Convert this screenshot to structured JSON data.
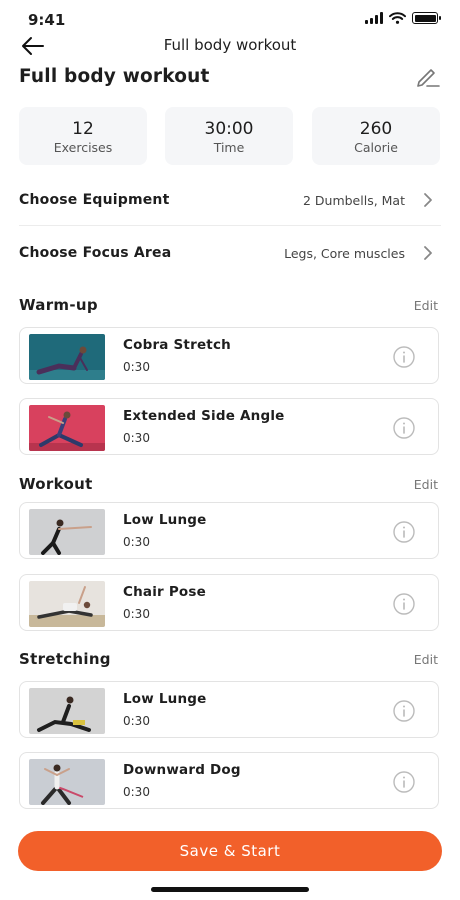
{
  "status_bar": {
    "time": "9:41"
  },
  "nav": {
    "title": "Full body workout"
  },
  "page": {
    "title": "Full body workout"
  },
  "stats": [
    {
      "value": "12",
      "label": "Exercises"
    },
    {
      "value": "30:00",
      "label": "Time"
    },
    {
      "value": "260",
      "label": "Calorie"
    }
  ],
  "settings": {
    "equipment": {
      "label": "Choose Equipment",
      "value": "2 Dumbells, Mat"
    },
    "focus": {
      "label": "Choose Focus Area",
      "value": "Legs, Core muscles"
    }
  },
  "sections": {
    "warmup": {
      "title": "Warm-up",
      "edit_label": "Edit",
      "items": [
        {
          "name": "Cobra Stretch",
          "duration": "0:30"
        },
        {
          "name": "Extended Side Angle",
          "duration": "0:30"
        }
      ]
    },
    "workout": {
      "title": "Workout",
      "edit_label": "Edit",
      "items": [
        {
          "name": "Low Lunge",
          "duration": "0:30"
        },
        {
          "name": "Chair Pose",
          "duration": "0:30"
        }
      ]
    },
    "stretching": {
      "title": "Stretching",
      "edit_label": "Edit",
      "items": [
        {
          "name": "Low Lunge",
          "duration": "0:30"
        },
        {
          "name": "Downward Dog",
          "duration": "0:30"
        }
      ]
    }
  },
  "actions": {
    "save_start_label": "Save & Start"
  },
  "colors": {
    "accent": "#f2602a",
    "card_bg": "#f5f6f8",
    "border": "#e3e3e3"
  }
}
